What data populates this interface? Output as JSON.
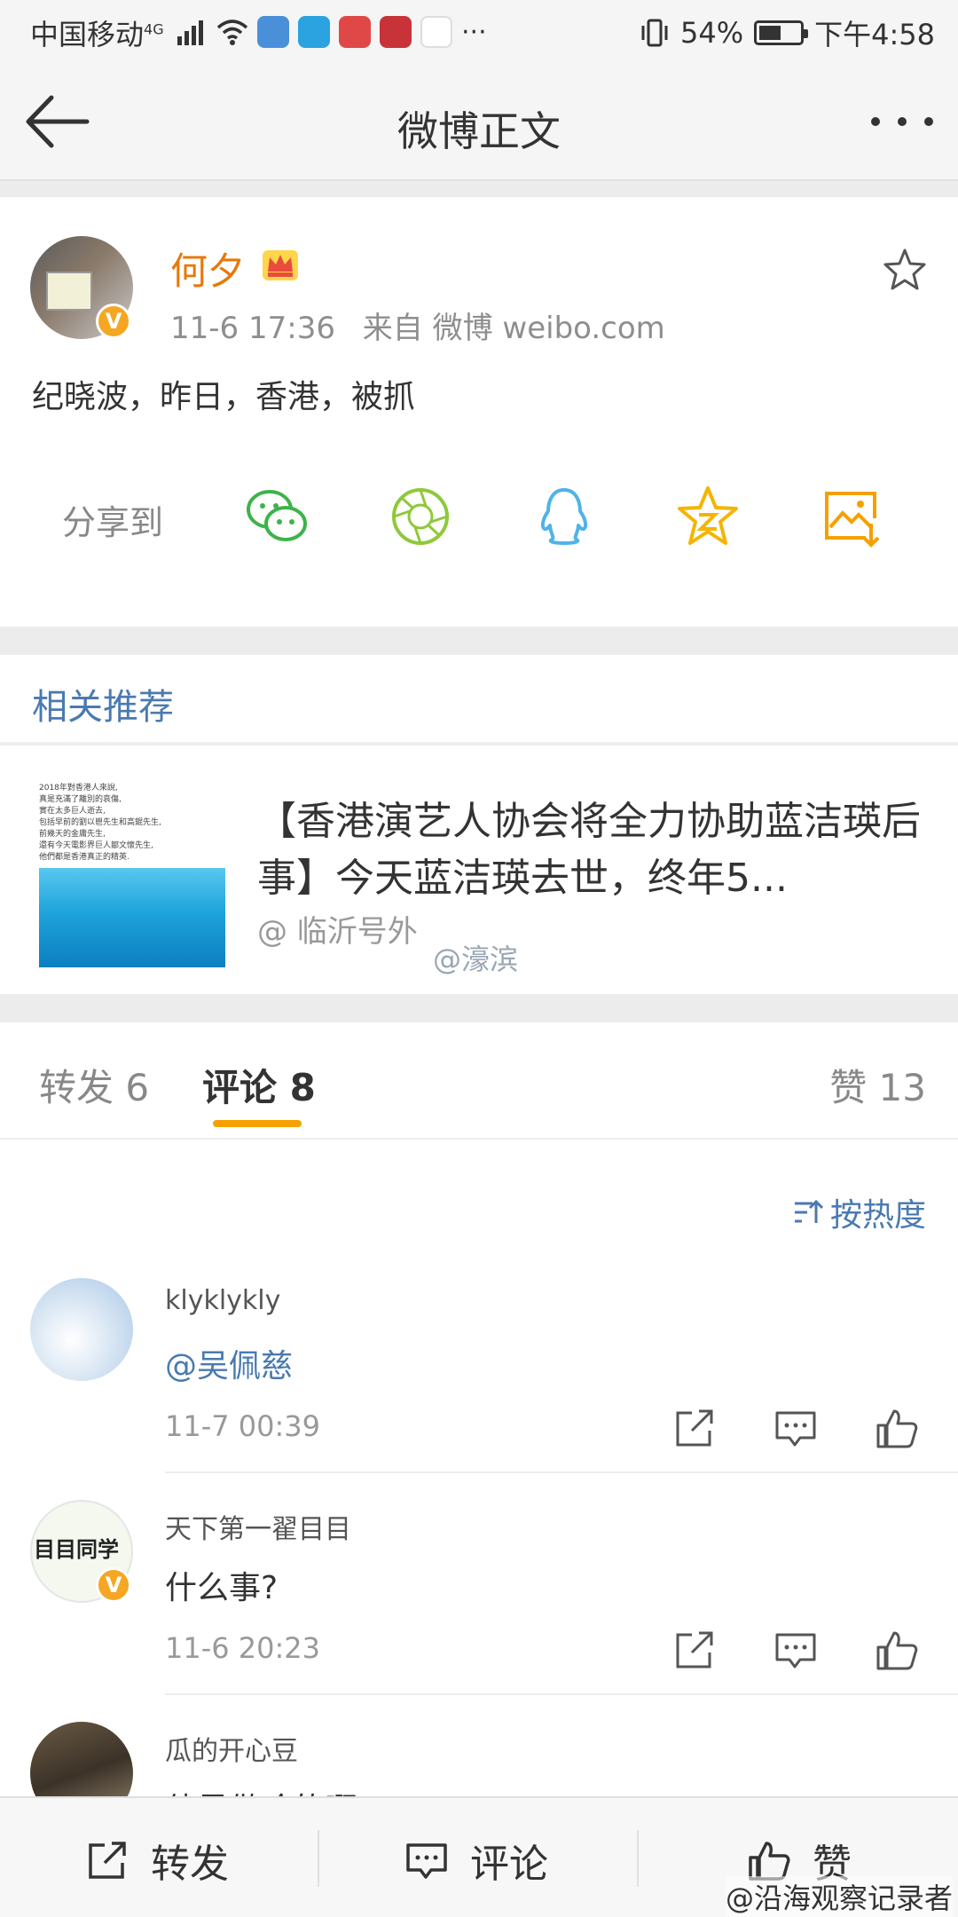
{
  "status_bar": {
    "carrier": "中国移动",
    "network": "4G",
    "battery": "54%",
    "battery_level": 0.54,
    "time": "下午4:58",
    "more": "···"
  },
  "nav": {
    "title": "微博正文"
  },
  "post": {
    "author": "何夕",
    "time": "11-6 17:36",
    "source": "来自 微博 weibo.com",
    "content": "纪晓波，昨日，香港，被抓",
    "verified_badge": "V"
  },
  "share": {
    "label": "分享到",
    "targets": [
      "wechat-icon",
      "moments-icon",
      "qq-icon",
      "qzone-icon",
      "save-image-icon"
    ]
  },
  "related": {
    "header": "相关推荐",
    "item": {
      "title": "【香港演艺人协会将全力协助蓝洁瑛后事】今天蓝洁瑛去世，终年5...",
      "source": "@ 临沂号外",
      "thumb_lines": [
        "2018年對香港人來說,",
        "真是充滿了離別的哀傷,",
        "實在太多巨人逝去,",
        "包括早前的劉以鬯先生和高錕先生,",
        "前幾天的金庸先生,",
        "還有今天電影界巨人鄒文懷先生,",
        "他們都是香港真正的精英."
      ]
    },
    "watermark": "@濠滨"
  },
  "tabs": {
    "repost": "转发 6",
    "comment": "评论 8",
    "like": "赞 13"
  },
  "sort_label": "按热度",
  "comments": [
    {
      "name": "klyklykly",
      "text": "@吴佩慈",
      "time": "11-7 00:39"
    },
    {
      "name": "天下第一翟目目",
      "text": "什么事?",
      "time": "11-6 20:23",
      "avatar_text": "目目同学"
    },
    {
      "name": "瓜的开心豆",
      "text": "他是做啥的啊"
    }
  ],
  "bottom_bar": {
    "repost": "转发",
    "comment": "评论",
    "like": "赞"
  },
  "bottom_watermark": "@沿海观察记录者",
  "colors": {
    "accent_orange": "#f7a100",
    "author_orange": "#e8780a",
    "link_blue": "#4a7ab0"
  }
}
